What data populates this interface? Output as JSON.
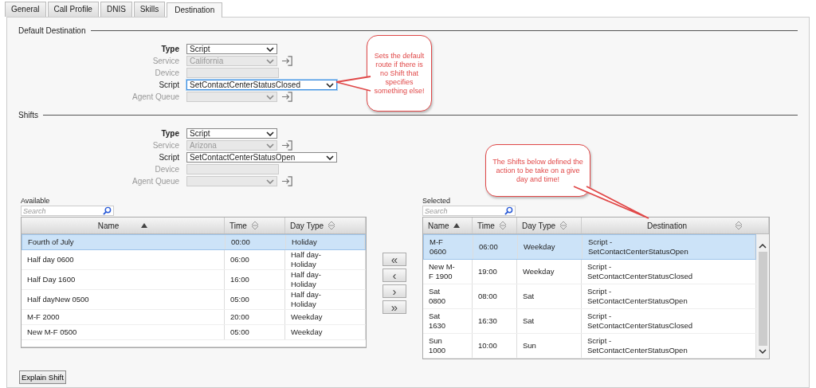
{
  "tabs": [
    {
      "label": "General",
      "selected": false
    },
    {
      "label": "Call Profile",
      "selected": false
    },
    {
      "label": "DNIS",
      "selected": false
    },
    {
      "label": "Skills",
      "selected": false
    },
    {
      "label": "Destination",
      "selected": true
    }
  ],
  "default_destination": {
    "title": "Default Destination",
    "fields": [
      {
        "label": "Type",
        "kind": "select",
        "value": "Script",
        "disabled": false,
        "emphasized": true
      },
      {
        "label": "Service",
        "kind": "select",
        "value": "California",
        "disabled": true,
        "link": true
      },
      {
        "label": "Device",
        "kind": "text",
        "disabled": true
      },
      {
        "label": "Script",
        "kind": "wide-select",
        "value": "SetContactCenterStatusClosed",
        "disabled": false,
        "focused": true
      },
      {
        "label": "Agent Queue",
        "kind": "select",
        "disabled": true,
        "link": true
      }
    ]
  },
  "shifts": {
    "title": "Shifts",
    "fields": [
      {
        "label": "Type",
        "kind": "select",
        "value": "Script",
        "disabled": false,
        "emphasized": true
      },
      {
        "label": "Service",
        "kind": "select",
        "value": "Arizona",
        "disabled": true,
        "link": true
      },
      {
        "label": "Script",
        "kind": "wide-select",
        "value": "SetContactCenterStatusOpen",
        "disabled": false
      },
      {
        "label": "Device",
        "kind": "text",
        "disabled": true
      },
      {
        "label": "Agent Queue",
        "kind": "select",
        "disabled": true,
        "link": true
      }
    ]
  },
  "available": {
    "label": "Available",
    "search_placeholder": "Search",
    "columns": [
      {
        "label": "Name",
        "sorted": true
      },
      {
        "label": "Time",
        "sorted": false
      },
      {
        "label": "Day Type",
        "sorted": false
      }
    ],
    "rows": [
      {
        "cells": [
          "Fourth of July",
          "00:00",
          "Holiday"
        ],
        "selected": true
      },
      {
        "cells": [
          "Half day 0600",
          "06:00",
          "Half day-\nHoliday"
        ],
        "selected": false
      },
      {
        "cells": [
          "Half Day 1600",
          "16:00",
          "Half day-\nHoliday"
        ],
        "selected": false
      },
      {
        "cells": [
          "Half dayNew 0500",
          "05:00",
          "Half day-\nHoliday"
        ],
        "selected": false
      },
      {
        "cells": [
          "M-F 2000",
          "20:00",
          "Weekday"
        ],
        "selected": false
      },
      {
        "cells": [
          "New M-F 0500",
          "05:00",
          "Weekday"
        ],
        "selected": false
      }
    ]
  },
  "transfer_buttons": [
    "«",
    "‹",
    "›",
    "»"
  ],
  "selected": {
    "label": "Selected",
    "search_placeholder": "Search",
    "columns": [
      {
        "label": "Name",
        "sorted": true
      },
      {
        "label": "Time",
        "sorted": false
      },
      {
        "label": "Day Type",
        "sorted": false
      },
      {
        "label": "Destination",
        "sorted": false
      }
    ],
    "rows": [
      {
        "cells": [
          "M-F\n0600",
          "06:00",
          "Weekday",
          "Script -\nSetContactCenterStatusOpen"
        ],
        "selected": true
      },
      {
        "cells": [
          "New M-\nF 1900",
          "19:00",
          "Weekday",
          "Script -\nSetContactCenterStatusClosed"
        ],
        "selected": false
      },
      {
        "cells": [
          "Sat\n0800",
          "08:00",
          "Sat",
          "Script -\nSetContactCenterStatusOpen"
        ],
        "selected": false
      },
      {
        "cells": [
          "Sat\n1630",
          "16:30",
          "Sat",
          "Script -\nSetContactCenterStatusClosed"
        ],
        "selected": false
      },
      {
        "cells": [
          "Sun\n1000",
          "10:00",
          "Sun",
          "Script -\nSetContactCenterStatusOpen"
        ],
        "selected": false
      }
    ]
  },
  "explain_button": "Explain Shift",
  "callouts": [
    {
      "text": "Sets the default route if there is no Shift that specifies something else!"
    },
    {
      "text": "The Shifts below defined the action to be take on a give day and time!"
    }
  ]
}
